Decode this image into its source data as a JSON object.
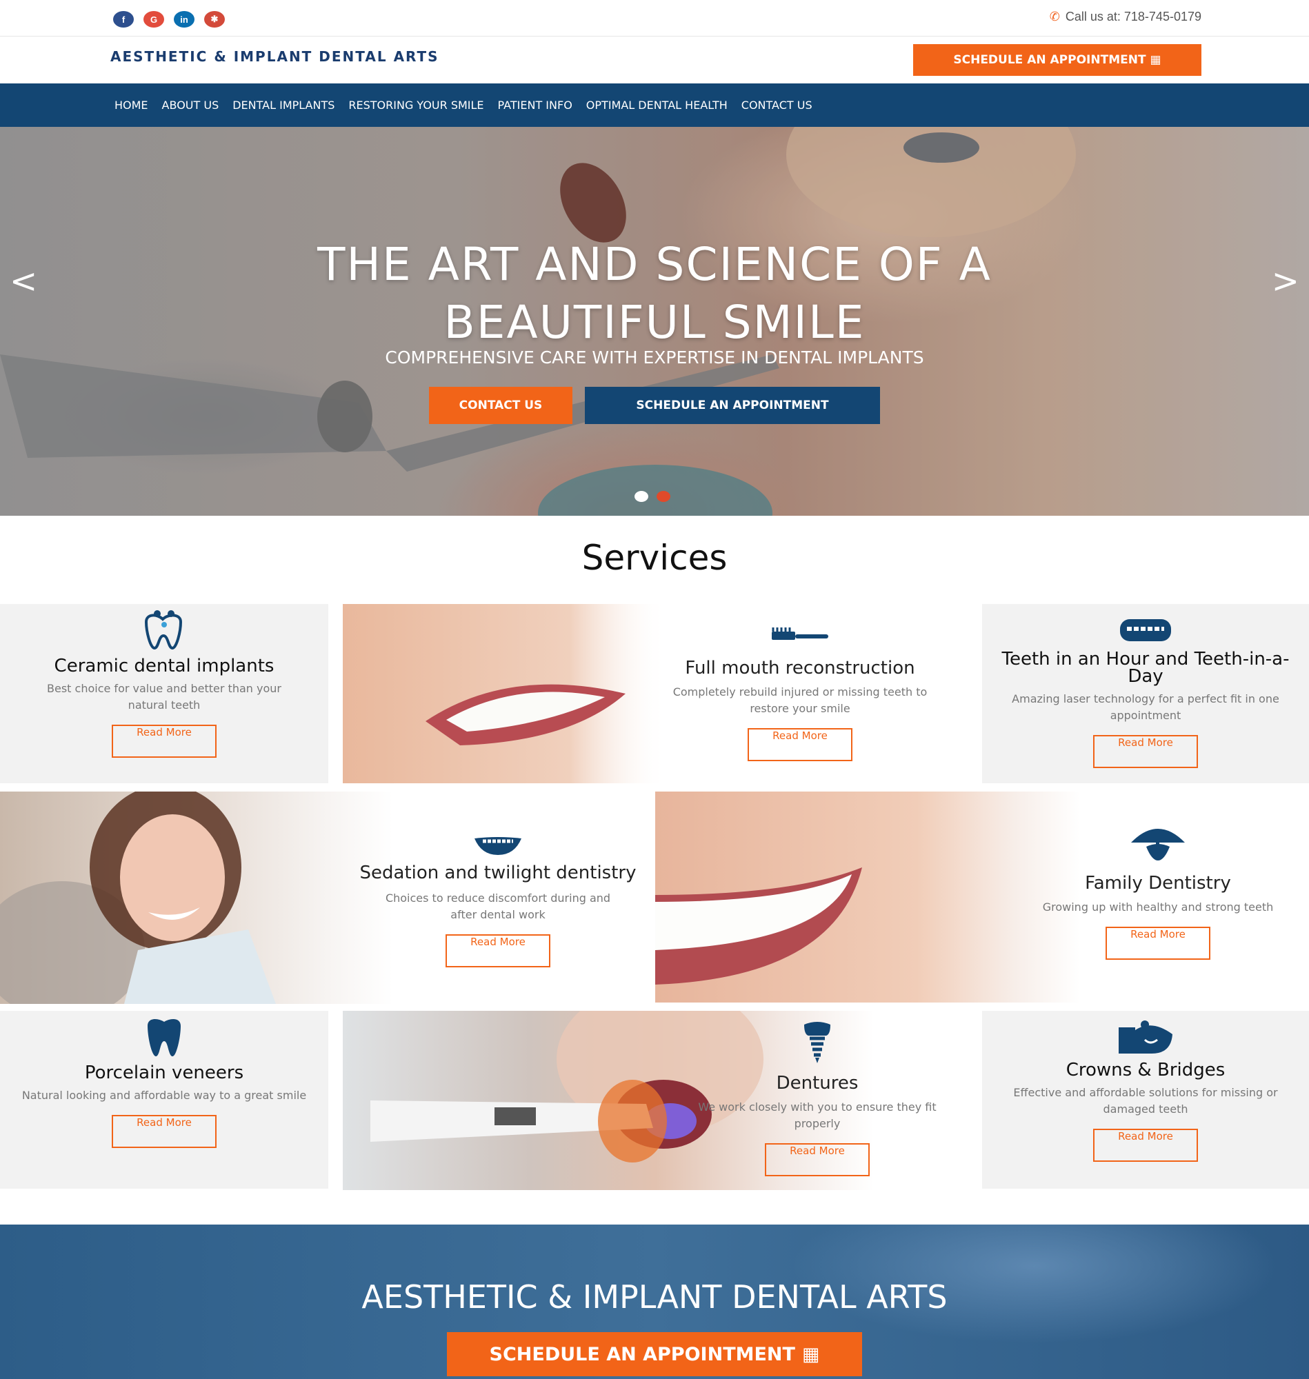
{
  "topbar": {
    "social": [
      "f",
      "G",
      "in",
      "yelp"
    ],
    "call_label": "Call us at: 718-745-0179"
  },
  "header": {
    "logo": "AESTHETIC & IMPLANT DENTAL ARTS",
    "schedule_label": "SCHEDULE AN APPOINTMENT"
  },
  "nav": {
    "items": [
      "HOME",
      "ABOUT US",
      "DENTAL IMPLANTS",
      "RESTORING YOUR SMILE",
      "PATIENT INFO",
      "OPTIMAL DENTAL HEALTH",
      "CONTACT US"
    ]
  },
  "hero": {
    "title_line1": "THE ART AND SCIENCE OF A",
    "title_line2": "BEAUTIFUL SMILE",
    "subtitle": "COMPREHENSIVE CARE WITH EXPERTISE IN DENTAL IMPLANTS",
    "contact_label": "CONTACT US",
    "appointment_label": "SCHEDULE AN APPOINTMENT"
  },
  "services": {
    "heading": "Services",
    "read_more": "Read More",
    "items": [
      {
        "title": "Ceramic dental implants",
        "desc": "Best choice for value and better than your natural teeth"
      },
      {
        "title": "Full mouth reconstruction",
        "desc": "Completely rebuild injured or missing teeth to restore your smile"
      },
      {
        "title": "Teeth in an Hour and Teeth-in-a-Day",
        "desc": "Amazing laser technology for a perfect fit in one appointment"
      },
      {
        "title": "Sedation and twilight dentistry",
        "desc": "Choices to reduce discomfort during and after dental work"
      },
      {
        "title": "Family Dentistry",
        "desc": "Growing up with healthy and strong teeth"
      },
      {
        "title": "Porcelain veneers",
        "desc": "Natural looking and affordable way to a great smile"
      },
      {
        "title": "Dentures",
        "desc": "We work closely with you to ensure they fit properly"
      },
      {
        "title": "Crowns & Bridges",
        "desc": "Effective and affordable solutions for missing or damaged teeth"
      }
    ]
  },
  "banner": {
    "title": "AESTHETIC & IMPLANT DENTAL ARTS",
    "button_label": "SCHEDULE AN APPOINTMENT"
  },
  "colors": {
    "accent": "#f26418",
    "navy": "#134673"
  }
}
